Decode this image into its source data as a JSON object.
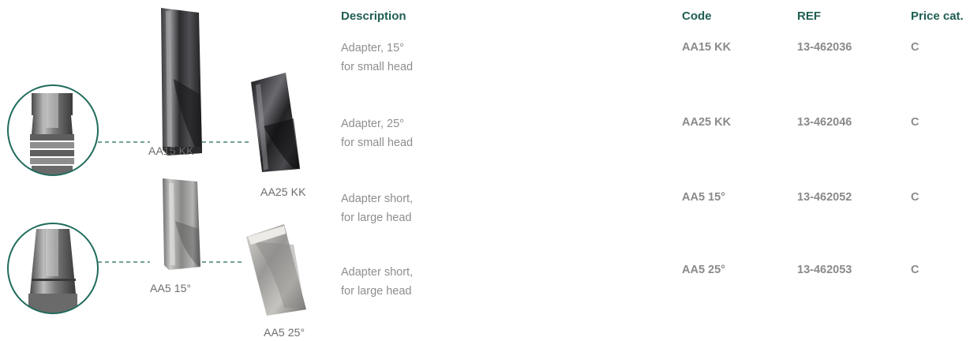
{
  "illustrations": {
    "captions": {
      "aa15kk": "AA15 KK",
      "aa25kk": "AA25 KK",
      "aa515": "AA5 15°",
      "aa525": "AA5 25°"
    },
    "accent_color": "#1f6b5c"
  },
  "table": {
    "headers": {
      "description": "Description",
      "code": "Code",
      "ref": "REF",
      "price": "Price cat."
    },
    "rows": [
      {
        "description_line1": "Adapter, 15°",
        "description_line2": "for small head",
        "code": "AA15 KK",
        "ref": "13-462036",
        "price": "C"
      },
      {
        "description_line1": "Adapter, 25°",
        "description_line2": "for small head",
        "code": "AA25 KK",
        "ref": "13-462046",
        "price": "C"
      },
      {
        "description_line1": "Adapter short,",
        "description_line2": "for large head",
        "code": "AA5 15°",
        "ref": "13-462052",
        "price": "C"
      },
      {
        "description_line1": "Adapter short,",
        "description_line2": "for large head",
        "code": "AA5 25°",
        "ref": "13-462053",
        "price": "C"
      }
    ]
  }
}
